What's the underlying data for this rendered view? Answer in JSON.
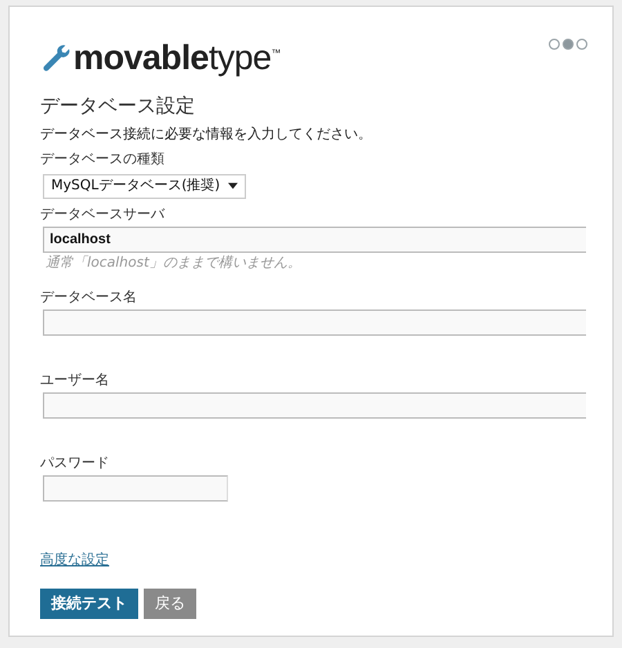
{
  "logo": {
    "text": "**movable**type$^{™}$"
  },
  "steps": [
    {
      "selected": false
    },
    {
      "selected": true
    },
    {
      "selected": false
    }
  ],
  "title": "データベース設定",
  "intro": "データベース接続に必要な情報を入力してください。",
  "db_type": {
    "label": "データベースの種類",
    "value": "MySQLデータベース(推奨)"
  },
  "fields": [
    {
      "label": "データベースサーバ",
      "kind": "text",
      "value": "localhost",
      "hint": "通常「localhost」のままで構いません。"
    },
    {
      "label": "データベース名",
      "kind": "text"
    },
    {
      "label": "ユーザー名",
      "kind": "text"
    },
    {
      "label": "パスワード",
      "kind": "password"
    }
  ],
  "advanced_link": "高度な設定",
  "buttons": [
    {
      "label": "接続テスト",
      "kind": "primary"
    },
    {
      "label": "戻る",
      "kind": "secondary"
    }
  ]
}
